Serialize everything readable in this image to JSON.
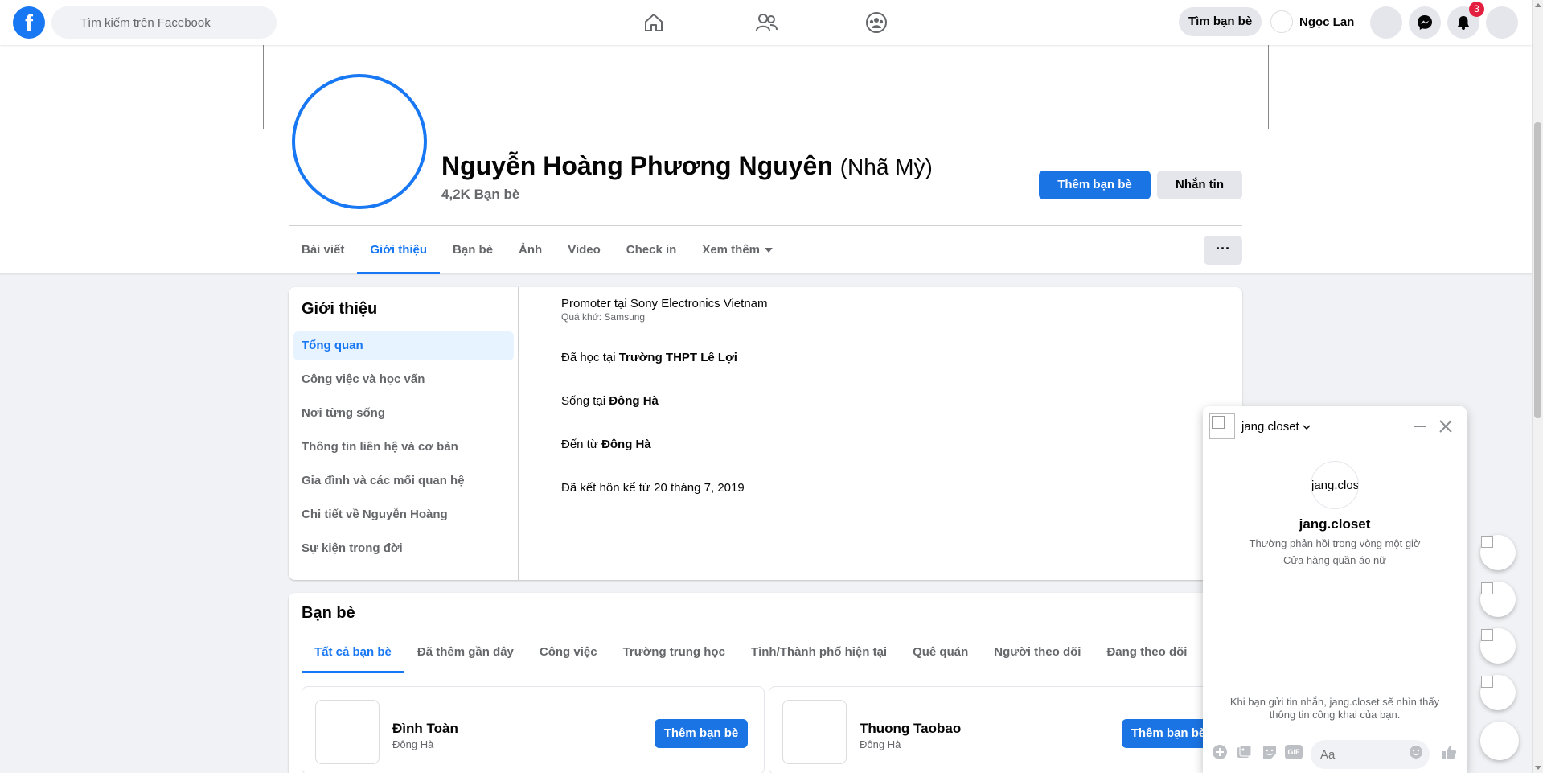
{
  "topbar": {
    "search_placeholder": "Tìm kiếm trên Facebook",
    "find_friends": "Tìm bạn bè",
    "user_name": "Ngọc Lan",
    "notification_count": "3",
    "icons": [
      "home-icon",
      "friends-icon",
      "groups-icon",
      "menu-icon",
      "messenger-icon",
      "bell-icon",
      "account-icon"
    ]
  },
  "profile": {
    "name": "Nguyễn Hoàng Phương Nguyên",
    "alt_name": "(Nhã Mỳ)",
    "friend_count": "4,2K Bạn bè",
    "add_friend": "Thêm bạn bè",
    "message": "Nhắn tin",
    "more": "···"
  },
  "tabs": [
    {
      "label": "Bài viết"
    },
    {
      "label": "Giới thiệu"
    },
    {
      "label": "Bạn bè"
    },
    {
      "label": "Ảnh"
    },
    {
      "label": "Video"
    },
    {
      "label": "Check in"
    },
    {
      "label": "Xem thêm"
    }
  ],
  "intro": {
    "title": "Giới thiệu",
    "menu": [
      "Tổng quan",
      "Công việc và học vấn",
      "Nơi từng sống",
      "Thông tin liên hệ và cơ bản",
      "Gia đình và các mối quan hệ",
      "Chi tiết về Nguyễn Hoàng",
      "Sự kiện trong đời"
    ],
    "work": "Promoter tại Sony Electronics Vietnam",
    "work_past": "Quá khứ: Samsung",
    "study_prefix": "Đã học tại ",
    "study_place": "Trường THPT Lê Lợi",
    "live_prefix": "Sống tại ",
    "live_place": "Đông Hà",
    "from_prefix": "Đến từ ",
    "from_place": "Đông Hà",
    "married": "Đã kết hôn kể từ 20 tháng 7, 2019"
  },
  "friends": {
    "title": "Bạn bè",
    "tabs": [
      "Tất cả bạn bè",
      "Đã thêm gần đây",
      "Công việc",
      "Trường trung học",
      "Tỉnh/Thành phố hiện tại",
      "Quê quán",
      "Người theo dõi",
      "Đang theo dõi"
    ],
    "items": [
      {
        "name": "Đình Toàn",
        "location": "Đông Hà",
        "button": "Thêm bạn bè"
      },
      {
        "name": "Thuong Taobao",
        "location": "Đông Hà",
        "button": "Thêm bạn bè"
      }
    ]
  },
  "chat": {
    "name": "jang.closet",
    "avatar_alt": "jang.clos",
    "title": "jang.closet",
    "reply_time": "Thường phản hồi trong vòng một giờ",
    "category": "Cửa hàng quần áo nữ",
    "notice": "Khi bạn gửi tin nhắn, jang.closet sẽ nhìn thấy thông tin công khai của bạn.",
    "input_placeholder": "Aa",
    "gif_label": "GIF"
  },
  "colors": {
    "brand": "#1877f2",
    "button_blue": "#1b74e4",
    "badge_red": "#e41e3f",
    "page_bg": "#f0f2f5"
  }
}
